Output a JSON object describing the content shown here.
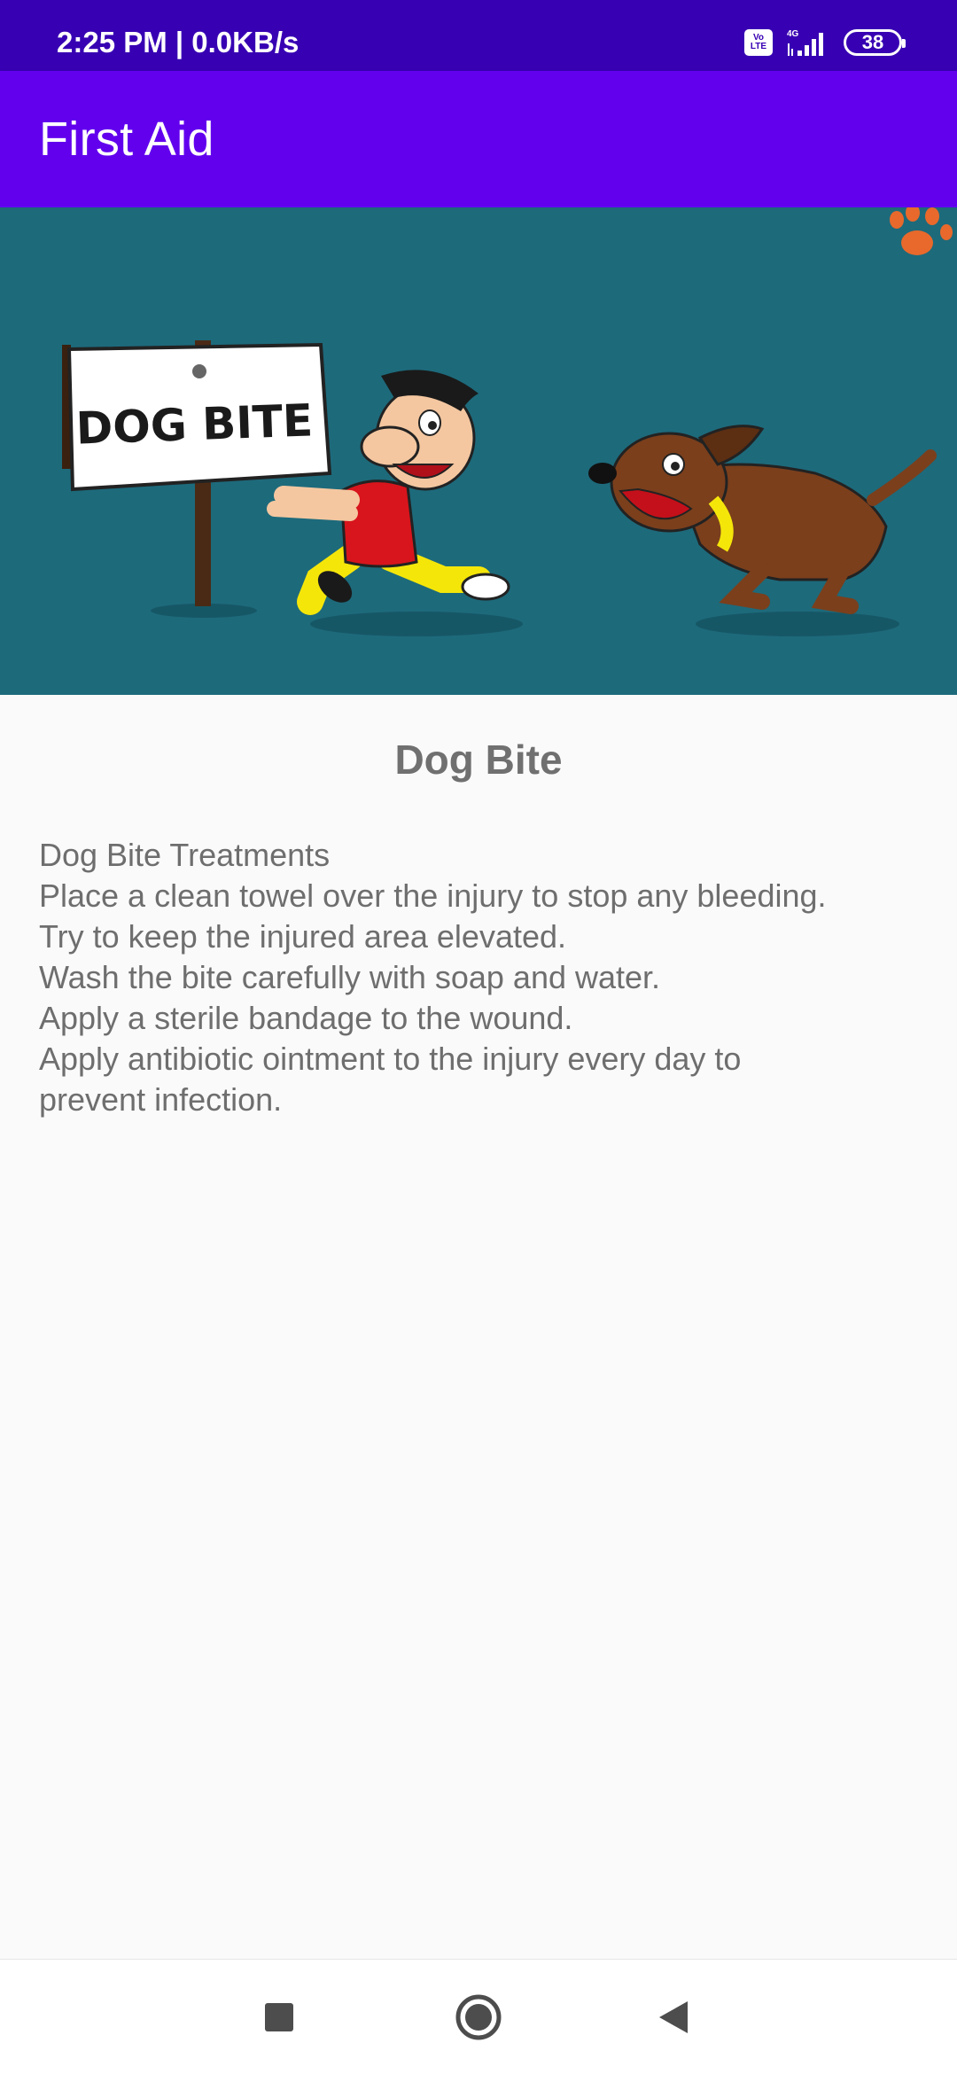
{
  "status_bar": {
    "time": "2:25 PM | 0.0KB/s",
    "volte_label": "Vo LTE",
    "network_label": "4G",
    "battery_level": "38",
    "icons": [
      "volte-icon",
      "signal-icon",
      "battery-icon"
    ]
  },
  "app_bar": {
    "title": "First Aid"
  },
  "hero": {
    "sign_text": "DOG BITE",
    "colors": {
      "background": "#1d6a7b",
      "paw": "#e8692b"
    }
  },
  "article": {
    "title": "Dog Bite",
    "lines": [
      "Dog Bite Treatments",
      "Place a clean towel over the injury to stop any bleeding.",
      "Try to keep the injured area elevated.",
      "Wash the bite carefully with soap and water.",
      "Apply a sterile bandage to the wound.",
      "Apply antibiotic ointment to the injury every day to prevent infection."
    ]
  },
  "nav_bar": {
    "buttons": [
      "recent-apps-icon",
      "home-icon",
      "back-icon"
    ]
  },
  "colors": {
    "status_bar": "#3700b3",
    "app_bar": "#6200ee",
    "page_background": "#fafafa",
    "text": "#6e6e6e"
  }
}
